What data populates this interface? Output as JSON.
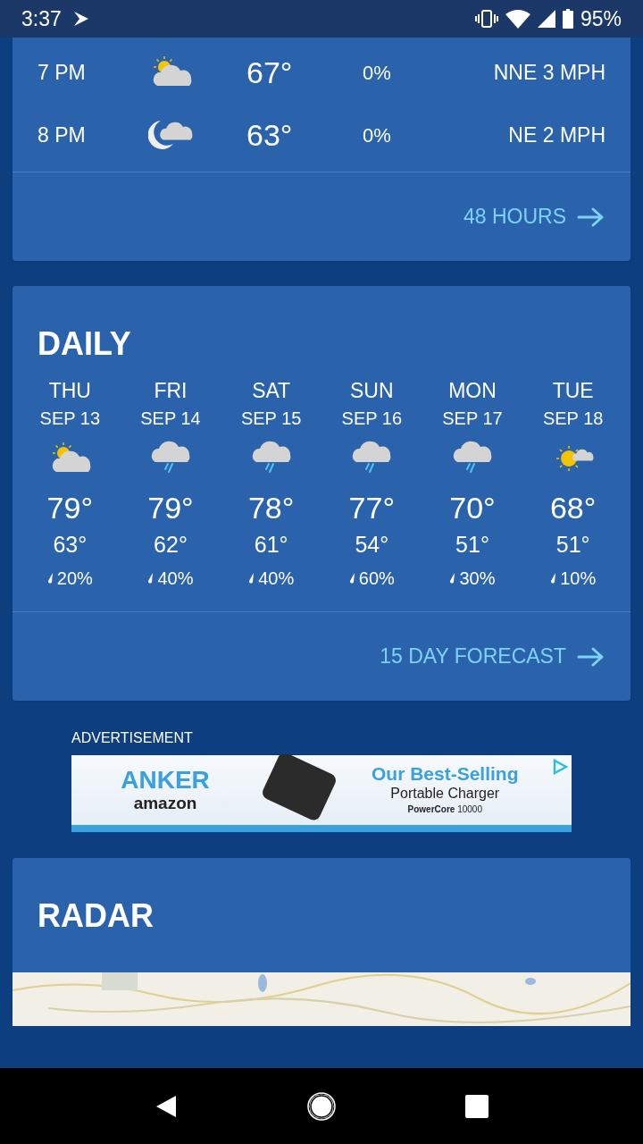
{
  "status_bar": {
    "time": "3:37",
    "battery": "95%"
  },
  "hourly": {
    "rows": [
      {
        "time": "7 PM",
        "kind": "partly-sunny",
        "temp": "67°",
        "precip": "0%",
        "wind": "NNE 3 MPH"
      },
      {
        "time": "8 PM",
        "kind": "night-cloudy",
        "temp": "63°",
        "precip": "0%",
        "wind": "NE 2 MPH"
      }
    ],
    "link": "48 HOURS"
  },
  "daily": {
    "title": "DAILY",
    "days": [
      {
        "day": "THU",
        "date": "SEP 13",
        "kind": "partly-sunny",
        "high": "79°",
        "low": "63°",
        "precip": "20%"
      },
      {
        "day": "FRI",
        "date": "SEP 14",
        "kind": "rain",
        "high": "79°",
        "low": "62°",
        "precip": "40%"
      },
      {
        "day": "SAT",
        "date": "SEP 15",
        "kind": "rain",
        "high": "78°",
        "low": "61°",
        "precip": "40%"
      },
      {
        "day": "SUN",
        "date": "SEP 16",
        "kind": "rain",
        "high": "77°",
        "low": "54°",
        "precip": "60%"
      },
      {
        "day": "MON",
        "date": "SEP 17",
        "kind": "rain",
        "high": "70°",
        "low": "51°",
        "precip": "30%"
      },
      {
        "day": "TUE",
        "date": "SEP 18",
        "kind": "sunny-cloud",
        "high": "68°",
        "low": "51°",
        "precip": "10%"
      }
    ],
    "link": "15 DAY FORECAST"
  },
  "ad": {
    "label": "ADVERTISEMENT",
    "brand": "ANKER",
    "store": "amazon",
    "headline": "Our Best-Selling",
    "subhead": "Portable Charger",
    "product_name": "PowerCore",
    "product_number": "10000"
  },
  "radar": {
    "title": "RADAR"
  }
}
